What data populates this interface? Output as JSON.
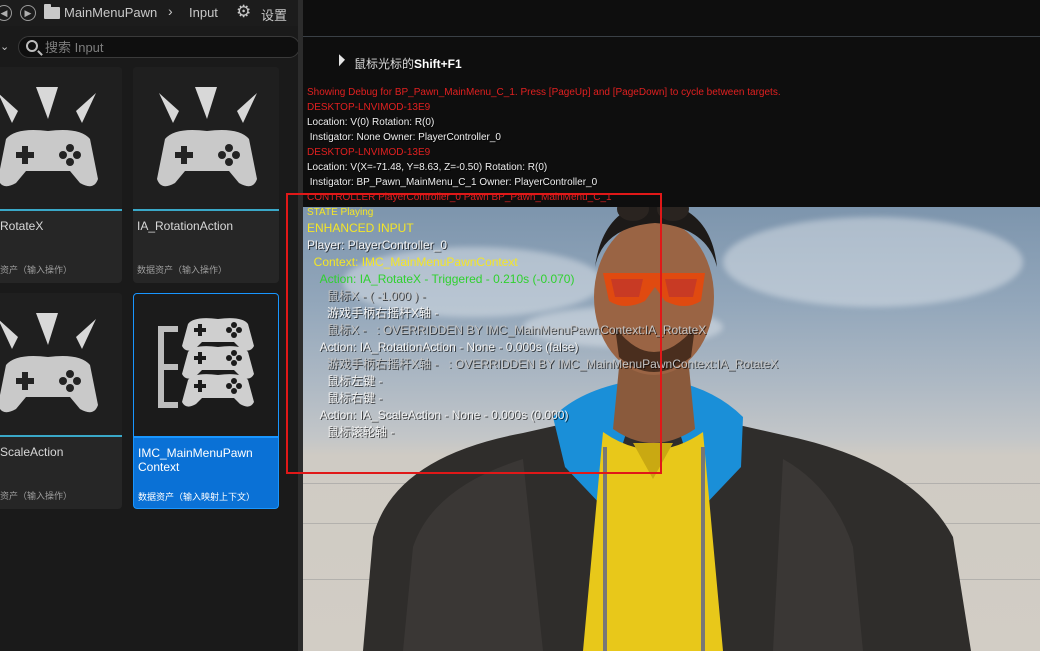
{
  "content_browser": {
    "breadcrumb": {
      "folder": "MainMenuPawn",
      "child": "Input",
      "settings": "设置"
    },
    "search": {
      "placeholder": "搜索 Input"
    },
    "assets": [
      {
        "name": "RotateX",
        "type": "资产（输入操作）",
        "icon": "gamepad-icon",
        "selected": false
      },
      {
        "name": "IA_RotationAction",
        "type": "数据资产（输入操作）",
        "icon": "gamepad-icon",
        "selected": false
      },
      {
        "name": "ScaleAction",
        "type": "资产（输入操作）",
        "icon": "gamepad-icon",
        "selected": false
      },
      {
        "name": "IMC_MainMenuPawn Context",
        "type": "数据资产（输入映射上下文）",
        "icon": "mapping-context-icon",
        "selected": true
      }
    ]
  },
  "viewport": {
    "hint": {
      "prefix": "鼠标光标的",
      "keys": "Shift+F1"
    },
    "debug_lines": [
      {
        "text": "Showing Debug for BP_Pawn_MainMenu_C_1. Press [PageUp] and [PageDown] to cycle between targets.",
        "color": "red"
      },
      {
        "text": "DESKTOP-LNVIMOD-13E9",
        "color": "red"
      },
      {
        "text": "Location: V(0) Rotation: R(0)",
        "color": "white"
      },
      {
        "text": " Instigator: None Owner: PlayerController_0",
        "color": "white"
      },
      {
        "text": "DESKTOP-LNVIMOD-13E9",
        "color": "red"
      },
      {
        "text": "Location: V(X=-71.48, Y=8.63, Z=-0.50) Rotation: R(0)",
        "color": "white"
      },
      {
        "text": " Instigator: BP_Pawn_MainMenu_C_1 Owner: PlayerController_0",
        "color": "white"
      },
      {
        "text": "CONTROLLER PlayerController_0 Pawn BP_Pawn_MainMenu_C_1",
        "color": "red"
      },
      {
        "text": "STATE Playing",
        "color": "yellow"
      },
      {
        "text": "ENHANCED INPUT",
        "color": "yellow-big"
      },
      {
        "text": "Player: PlayerController_0",
        "color": "white-big"
      },
      {
        "text": "  Context: IMC_MainMenuPawnContext",
        "color": "yellow-big"
      },
      {
        "text": "    Action: IA_RotateX - Triggered - 0.210s (-0.070)",
        "color": "green-big"
      },
      {
        "text": "      鼠标X - ( -1.000 ) -",
        "color": "grey-big"
      },
      {
        "text": "      游戏手柄右摇杆X轴 -",
        "color": "white-big"
      },
      {
        "text": "      鼠标X -   : OVERRIDDEN BY IMC_MainMenuPawnContext:IA_RotateX",
        "color": "grey-big"
      },
      {
        "text": "    Action: IA_RotationAction - None - 0.000s (false)",
        "color": "white-big"
      },
      {
        "text": "      游戏手柄右摇杆X轴 -   : OVERRIDDEN BY IMC_MainMenuPawnContext:IA_RotateX",
        "color": "grey-big"
      },
      {
        "text": "      鼠标左键 -",
        "color": "white-big"
      },
      {
        "text": "      鼠标右键 -",
        "color": "white-big"
      },
      {
        "text": "    Action: IA_ScaleAction - None - 0.000s (0.000)",
        "color": "white-big"
      },
      {
        "text": "      鼠标滚轮轴 -",
        "color": "white-big"
      }
    ],
    "highlight_color": "#e01818"
  }
}
